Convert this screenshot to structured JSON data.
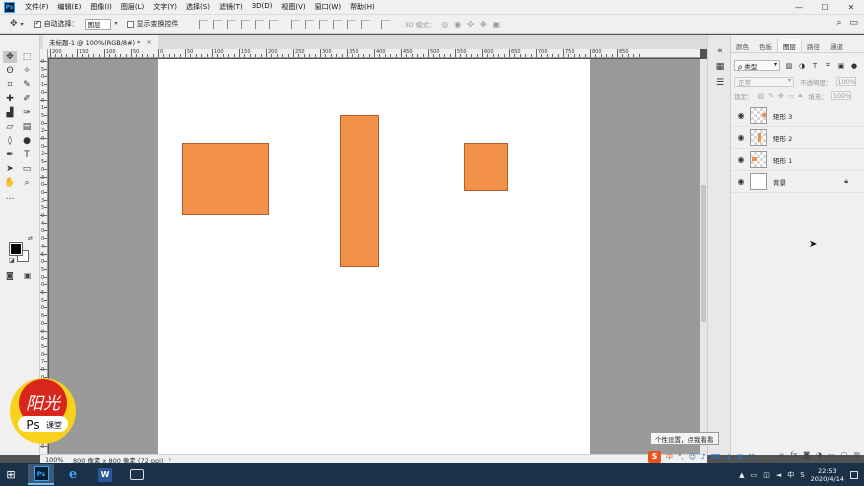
{
  "menubar": {
    "logo": "Ps",
    "items": [
      "文件(F)",
      "编辑(E)",
      "图像(I)",
      "图层(L)",
      "文字(Y)",
      "选择(S)",
      "滤镜(T)",
      "3D(D)",
      "视图(V)",
      "窗口(W)",
      "帮助(H)"
    ],
    "window_controls": [
      "—",
      "☐",
      "✕"
    ]
  },
  "options": {
    "auto_select_label": "自动选择：",
    "auto_select_checked": true,
    "auto_select_value": "图层",
    "transform_controls_label": "显示变换控件",
    "transform_controls_checked": false,
    "mode_3d_label": "3D 模式："
  },
  "document": {
    "tab_title": "未标题-1 @ 100%(RGB/8#) *",
    "tab_close": "×"
  },
  "rulers": {
    "horizontal_labels": [
      "200",
      "150",
      "100",
      "50",
      "0",
      "50",
      "100",
      "150",
      "200",
      "250",
      "300",
      "350",
      "400",
      "450",
      "500",
      "550",
      "600",
      "650",
      "700",
      "750",
      "800",
      "850"
    ],
    "vertical_labels": [
      "0",
      "5",
      "0",
      "1",
      "0",
      "0",
      "1",
      "5",
      "0",
      "2",
      "0",
      "0",
      "2",
      "5",
      "0",
      "3",
      "0",
      "0",
      "3",
      "5",
      "0",
      "4",
      "0",
      "0",
      "4",
      "5",
      "0",
      "5",
      "0",
      "0",
      "5",
      "5",
      "0",
      "6",
      "0",
      "0",
      "6",
      "5",
      "0",
      "7",
      "0",
      "0",
      "7",
      "5",
      "0",
      "8",
      "0",
      "0",
      "8",
      "5",
      "0"
    ]
  },
  "canvas": {
    "background": "#ffffff",
    "pasteboard": "#9a9a9a",
    "shape_fill": "#f2914a",
    "shape_stroke": "#b45b2a"
  },
  "status": {
    "zoom": "100%",
    "doc_info": "800 像素 x 800 像素 (72 ppi)",
    "arrow": "›"
  },
  "panel": {
    "tabs": [
      "颜色",
      "色板",
      "图层",
      "路径",
      "通道"
    ],
    "active_tab": "图层",
    "filter_kind": "ρ 类型",
    "blend_mode": "正常",
    "opacity_label": "不透明度：",
    "opacity_value": "100%",
    "lock_label": "锁定：",
    "fill_label": "填充：",
    "fill_value": "100%",
    "layers": [
      {
        "name": "矩形 3",
        "visible": true,
        "locked": false,
        "thumb": "transparent"
      },
      {
        "name": "矩形 2",
        "visible": true,
        "locked": false,
        "thumb": "transparent"
      },
      {
        "name": "矩形 1",
        "visible": true,
        "locked": false,
        "thumb": "transparent"
      },
      {
        "name": "背景",
        "visible": true,
        "locked": true,
        "thumb": "white"
      }
    ]
  },
  "tooltip": {
    "text": "个性设置，点我看看"
  },
  "ime": {
    "logo": "S",
    "mode": "中"
  },
  "taskbar": {
    "tray_ime": "中",
    "time": "22:53",
    "date": "2020/4/14"
  },
  "watermark": {
    "text_top": "阳光",
    "text_brand": "Ps",
    "text_sub": "课堂",
    "color_red": "#d9261c",
    "color_yellow": "#f7d21d"
  }
}
